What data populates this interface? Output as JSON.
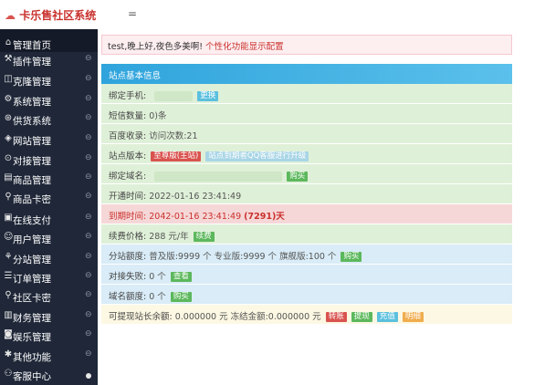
{
  "brand": {
    "title": "卡乐售社区系统",
    "logo_icon": "cloud-icon",
    "menu_toggle": "="
  },
  "sidebar": {
    "items": [
      {
        "icon": "⌂",
        "label": "管理首页",
        "arrow": ""
      },
      {
        "icon": "⚒",
        "label": "插件管理",
        "arrow": "⊖"
      },
      {
        "icon": "◫",
        "label": "克隆管理",
        "arrow": "⊖"
      },
      {
        "icon": "⚙",
        "label": "系统管理",
        "arrow": "⊖"
      },
      {
        "icon": "⊛",
        "label": "供货系统",
        "arrow": "⊖"
      },
      {
        "icon": "◈",
        "label": "网站管理",
        "arrow": "⊖"
      },
      {
        "icon": "⊙",
        "label": "对接管理",
        "arrow": "⊖"
      },
      {
        "icon": "▤",
        "label": "商品管理",
        "arrow": "⊖"
      },
      {
        "icon": "⚲",
        "label": "商品卡密",
        "arrow": "⊖"
      },
      {
        "icon": "▣",
        "label": "在线支付",
        "arrow": "⊖"
      },
      {
        "icon": "☺",
        "label": "用户管理",
        "arrow": "⊖"
      },
      {
        "icon": "⚘",
        "label": "分站管理",
        "arrow": "⊖"
      },
      {
        "icon": "☰",
        "label": "订单管理",
        "arrow": "⊖"
      },
      {
        "icon": "⚲",
        "label": "社区卡密",
        "arrow": "⊖"
      },
      {
        "icon": "▥",
        "label": "财务管理",
        "arrow": "⊖"
      },
      {
        "icon": "◙",
        "label": "娱乐管理",
        "arrow": "⊖"
      },
      {
        "icon": "✱",
        "label": "其他功能",
        "arrow": "⊖"
      },
      {
        "icon": "⚇",
        "label": "客服中心",
        "arrow": ""
      }
    ]
  },
  "notice": {
    "text": "test,晚上好,夜色多美啊!",
    "link": "个性化功能显示配置"
  },
  "panel": {
    "title": "站点基本信息"
  },
  "info": {
    "phone_label": "绑定手机:",
    "phone_btn": "更换",
    "sms_label": "短信数量:",
    "sms_value": "0)条",
    "baidu_label": "百度收录:",
    "baidu_value": "访问次数:21",
    "version_label": "站点版本:",
    "version_badge": "至尊版(主站)",
    "version_note": "站点到期者QQ客服进行升级",
    "domain_label": "绑定域名:",
    "domain_btn": "购买",
    "open_label": "开通时间:",
    "open_value": "2022-01-16 23:41:49",
    "expire_label": "到期时间:",
    "expire_value": "2042-01-16 23:41:49",
    "expire_days": "(7291)天",
    "renew_label": "续费价格:",
    "renew_value": "288 元/年",
    "renew_btn": "续费",
    "quota_label": "分站额度:",
    "quota_value": "普及版:9999 个 专业版:9999 个 旗舰版:100 个",
    "quota_btn": "购买",
    "fail_label": "对接失败:",
    "fail_value": "0 个",
    "fail_btn": "查看",
    "domquota_label": "域名额度:",
    "domquota_value": "0 个",
    "domquota_btn": "购买",
    "balance_label": "可提现站长余额:",
    "balance_value": "0.000000 元 冻结金额:0.000000 元",
    "balance_btns": [
      "转账",
      "提现",
      "充值",
      "明细"
    ]
  }
}
